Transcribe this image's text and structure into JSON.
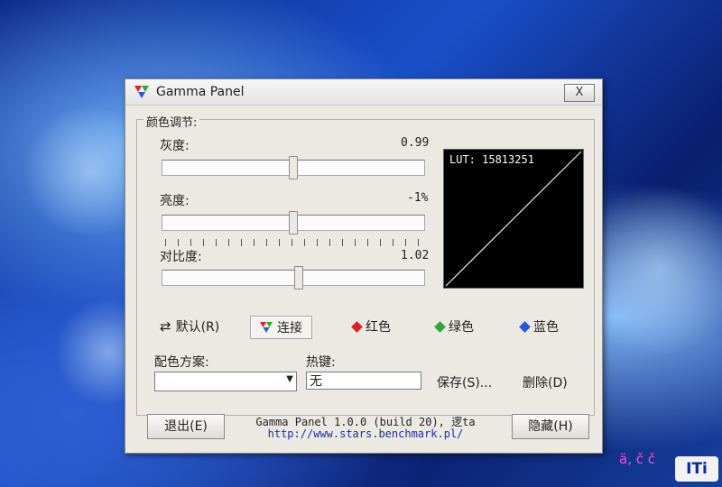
{
  "window": {
    "title": "Gamma Panel",
    "close_label": "X"
  },
  "color_adjust": {
    "group_title": "颜色调节:",
    "gray": {
      "label": "灰度:",
      "value_text": "0.99",
      "position": 0.5
    },
    "brightness": {
      "label": "亮度:",
      "value_text": "-1%",
      "position": 0.5
    },
    "contrast": {
      "label": "对比度:",
      "value_text": "1.02",
      "position": 0.52
    },
    "lut_label": "LUT: 15813251"
  },
  "channels": [
    {
      "label": "默认(R)",
      "icon": "refresh-icon"
    },
    {
      "label": "连接",
      "icon": "rgb-diamond-icon",
      "active": true
    },
    {
      "label": "红色",
      "icon": "red-diamond-icon",
      "color": "#d8222a"
    },
    {
      "label": "绿色",
      "icon": "green-diamond-icon",
      "color": "#2fa836"
    },
    {
      "label": "蓝色",
      "icon": "blue-diamond-icon",
      "color": "#2a58d8"
    }
  ],
  "scheme": {
    "label": "配色方案:",
    "selected": ""
  },
  "hotkey": {
    "label": "热键:",
    "value": "无"
  },
  "save_label": "保存(S)...",
  "delete_label": "删除(D)",
  "exit_label": "退出(E)",
  "hide_label": "隐藏(H)",
  "footer": {
    "line1": "Gamma Panel 1.0.0 (build 20), 逻ta",
    "line2": "http://www.stars.benchmark.pl/"
  },
  "watermark": "ä, č č",
  "logo_text": "ITi"
}
